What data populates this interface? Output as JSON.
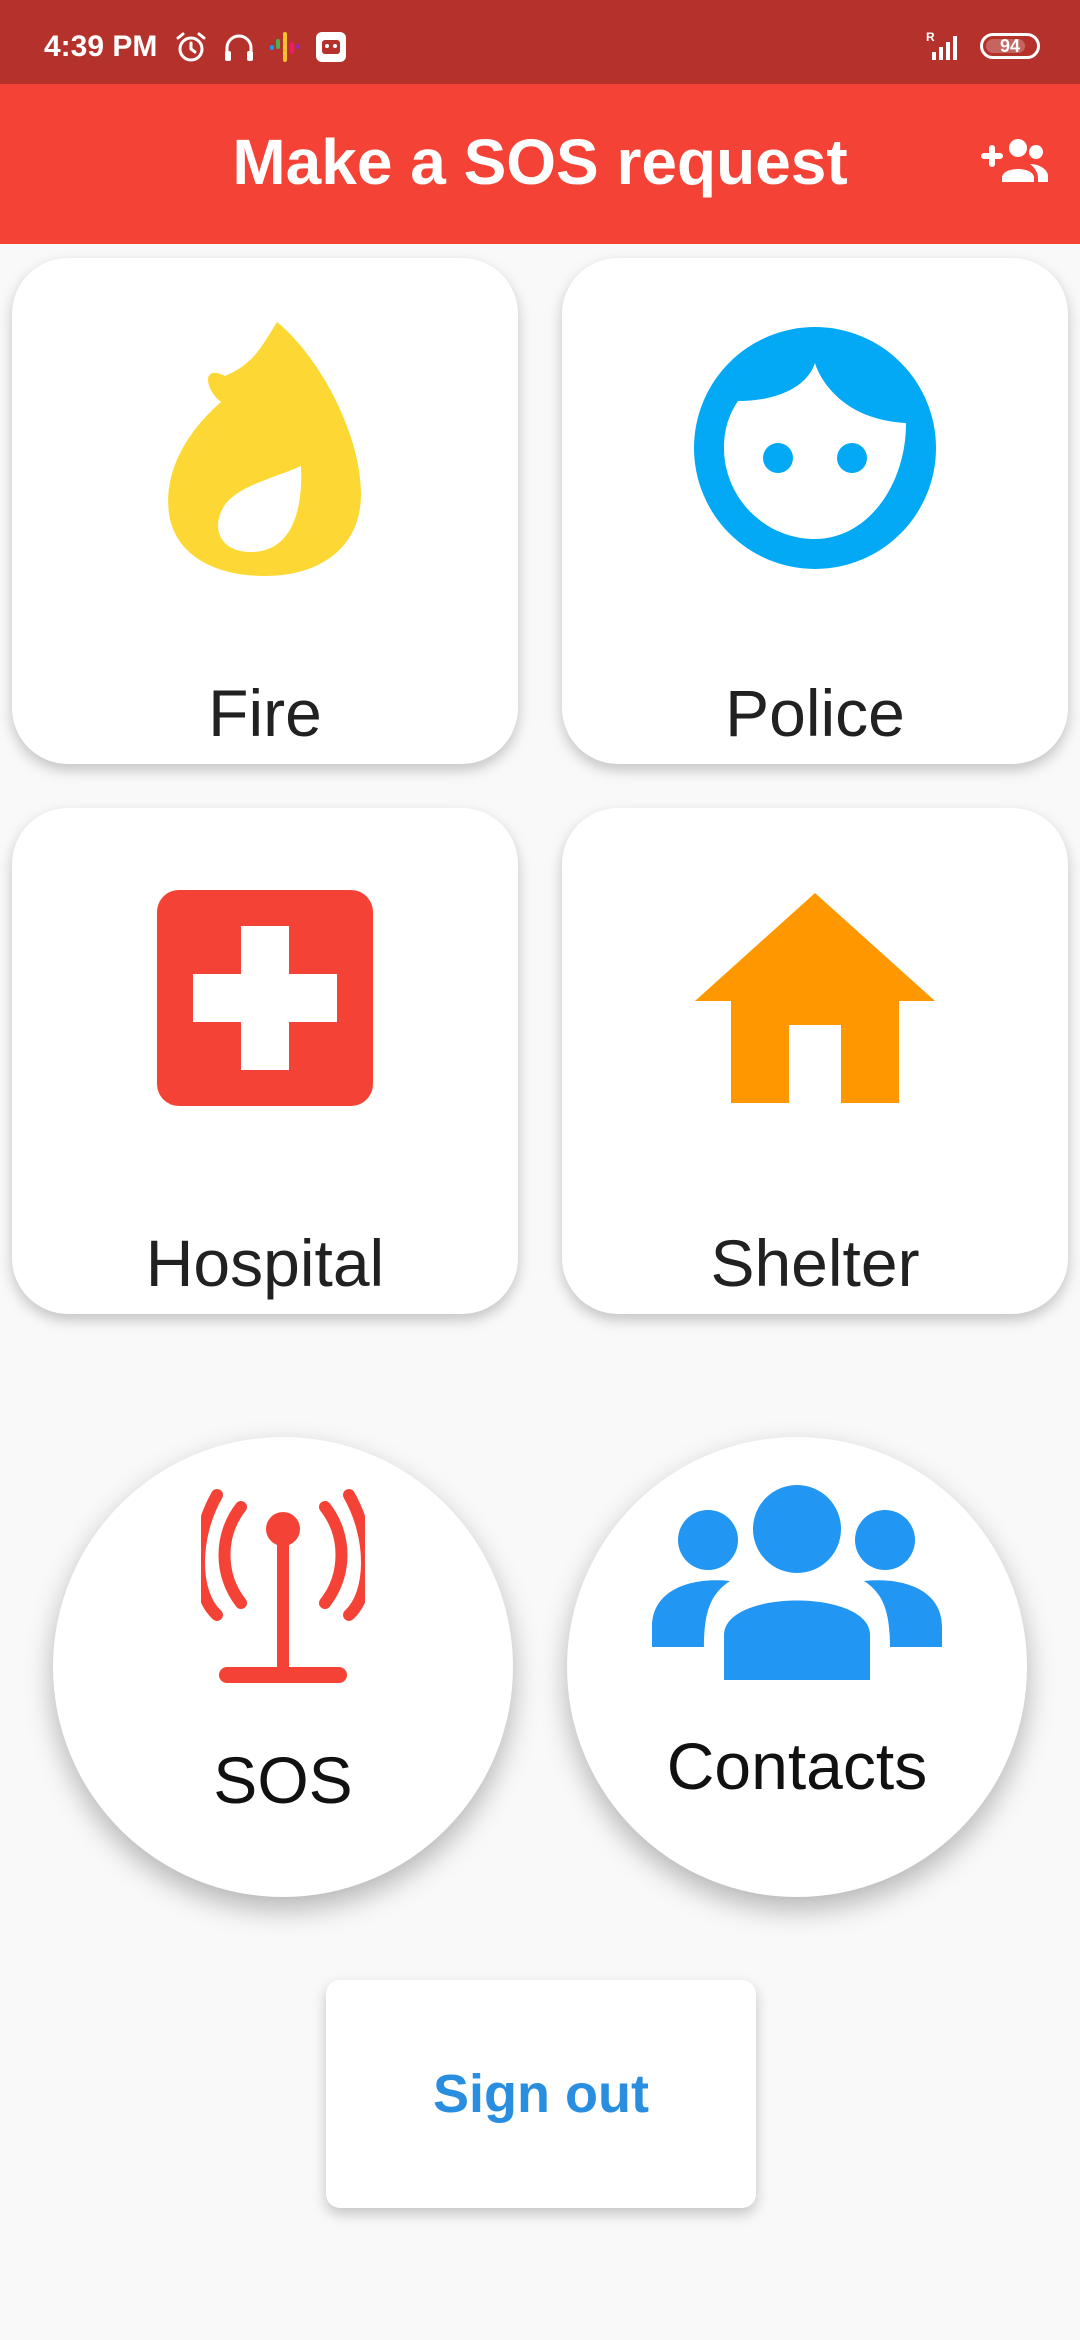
{
  "status_bar": {
    "time": "4:39 PM",
    "icons": [
      "alarm-icon",
      "headphones-icon",
      "podcasts-icon",
      "app-notification-icon",
      "signal-icon"
    ],
    "battery": "94",
    "color": "#b5312b"
  },
  "app_bar": {
    "title": "Make a SOS request",
    "action_icon": "add-contact-icon",
    "color": "#f44336"
  },
  "tiles": [
    {
      "label": "Fire",
      "icon": "flame-icon",
      "color": "#fdd835"
    },
    {
      "label": "Police",
      "icon": "face-icon",
      "color": "#03a9f4"
    },
    {
      "label": "Hospital",
      "icon": "medical-cross-icon",
      "color": "#f44336"
    },
    {
      "label": "Shelter",
      "icon": "house-icon",
      "color": "#ff9800"
    }
  ],
  "actions": [
    {
      "label": "SOS",
      "icon": "antenna-icon",
      "color": "#f44336"
    },
    {
      "label": "Contacts",
      "icon": "group-icon",
      "color": "#2196f3"
    }
  ],
  "sign_out": {
    "label": "Sign out",
    "color": "#2a8ee0"
  }
}
